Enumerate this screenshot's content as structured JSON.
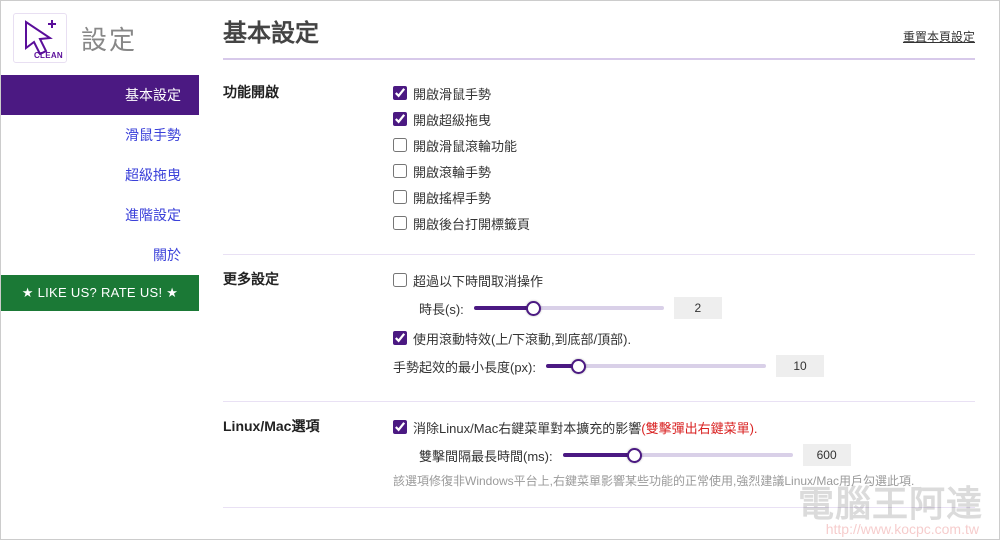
{
  "app": {
    "title": "設定",
    "logo_text": "CLEAN"
  },
  "sidebar": {
    "items": [
      "基本設定",
      "滑鼠手勢",
      "超級拖曳",
      "進階設定",
      "關於"
    ],
    "rate": "★ LIKE US? RATE US! ★"
  },
  "page": {
    "title": "基本設定",
    "reset": "重置本頁設定"
  },
  "sec1": {
    "label": "功能開啟",
    "opts": [
      {
        "label": "開啟滑鼠手勢",
        "checked": true
      },
      {
        "label": "開啟超級拖曳",
        "checked": true
      },
      {
        "label": "開啟滑鼠滾輪功能",
        "checked": false
      },
      {
        "label": "開啟滾輪手勢",
        "checked": false
      },
      {
        "label": "開啟搖桿手勢",
        "checked": false
      },
      {
        "label": "開啟後台打開標籤頁",
        "checked": false
      }
    ]
  },
  "sec2": {
    "label": "更多設定",
    "timeout_opt": "超過以下時間取消操作",
    "timeout_checked": false,
    "timeout_lbl": "時長(s):",
    "timeout_val": "2",
    "scroll_opt": "使用滾動特效(上/下滾動,到底部/頂部).",
    "scroll_checked": true,
    "minlen_lbl": "手勢起效的最小長度(px):",
    "minlen_val": "10"
  },
  "sec3": {
    "label": "Linux/Mac選項",
    "fix_opt": "消除Linux/Mac右鍵菜單對本擴充的影響",
    "fix_checked": true,
    "fix_red": "(雙擊彈出右鍵菜單).",
    "dbl_lbl": "雙擊間隔最長時間(ms):",
    "dbl_val": "600",
    "hint": "該選項修復非Windows平台上,右鍵菜單影響某些功能的正常使用,強烈建議Linux/Mac用戶勾選此項."
  },
  "watermark": {
    "brand": "電腦王阿達",
    "url": "http://www.kocpc.com.tw"
  }
}
